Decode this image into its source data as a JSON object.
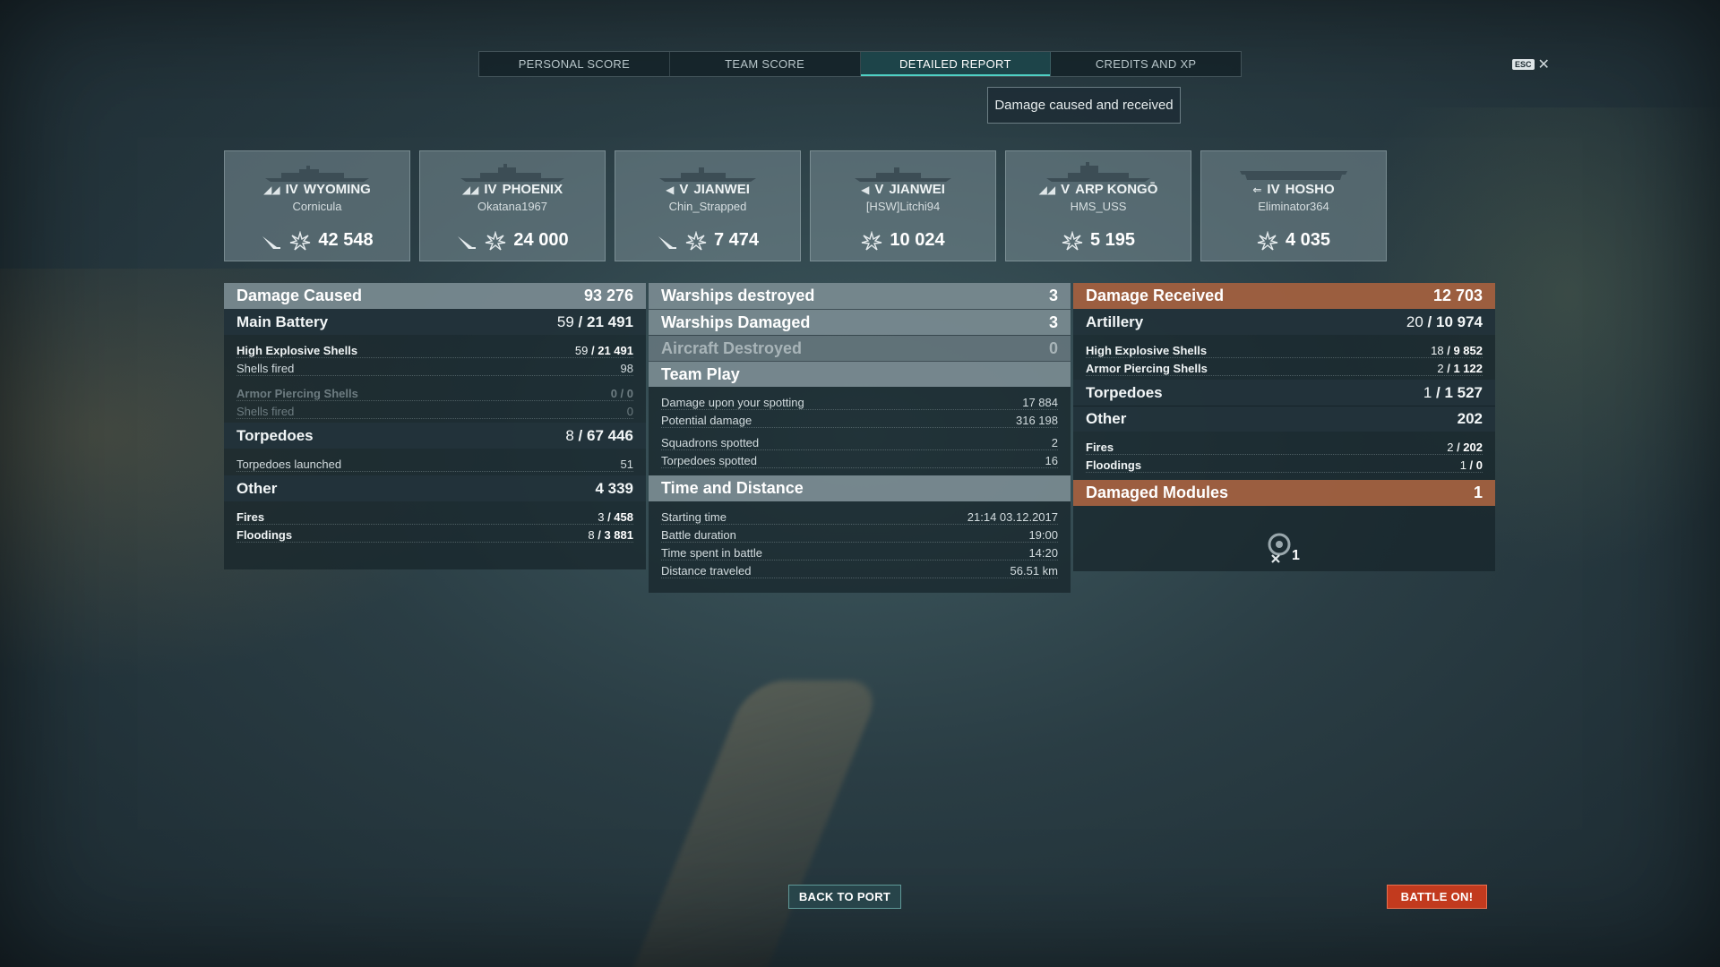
{
  "tabs": [
    {
      "label": "PERSONAL SCORE",
      "active": false
    },
    {
      "label": "TEAM SCORE",
      "active": false
    },
    {
      "label": "DETAILED REPORT",
      "active": true
    },
    {
      "label": "CREDITS AND XP",
      "active": false
    }
  ],
  "close": {
    "esc_label": "ESC",
    "x_label": "✕"
  },
  "subtab": {
    "label": "Damage caused and received"
  },
  "ships": [
    {
      "tier": "IV",
      "name": "WYOMING",
      "player": "Cornicula",
      "damage": "42 548",
      "class": "battleship",
      "plane_icon": true
    },
    {
      "tier": "IV",
      "name": "PHOENIX",
      "player": "Okatana1967",
      "damage": "24 000",
      "class": "battleship",
      "plane_icon": true
    },
    {
      "tier": "V",
      "name": "JIANWEI",
      "player": "Chin_Strapped",
      "damage": "7 474",
      "class": "cruiser",
      "plane_icon": true
    },
    {
      "tier": "V",
      "name": "JIANWEI",
      "player": "[HSW]Litchi94",
      "damage": "10 024",
      "class": "cruiser",
      "plane_icon": false
    },
    {
      "tier": "V",
      "name": "ARP KONGŌ",
      "player": "HMS_USS",
      "damage": "5 195",
      "class": "battleship",
      "plane_icon": false
    },
    {
      "tier": "IV",
      "name": "HOSHO",
      "player": "Eliminator364",
      "damage": "4 035",
      "class": "carrier",
      "plane_icon": false
    }
  ],
  "damage_caused": {
    "title": "Damage Caused",
    "total": "93 276",
    "main_battery": {
      "label": "Main Battery",
      "hits": "59",
      "damage": "21 491"
    },
    "he": {
      "label": "High Explosive Shells",
      "hits": "59",
      "damage": "21 491"
    },
    "he_fired": {
      "label": "Shells fired",
      "value": "98"
    },
    "ap": {
      "label": "Armor Piercing Shells",
      "value": "0 / 0"
    },
    "ap_fired": {
      "label": "Shells fired",
      "value": "0"
    },
    "torpedoes": {
      "label": "Torpedoes",
      "hits": "8",
      "damage": "67 446"
    },
    "torp_launched": {
      "label": "Torpedoes launched",
      "value": "51"
    },
    "other": {
      "label": "Other",
      "value": "4 339"
    },
    "fires": {
      "label": "Fires",
      "hits": "3",
      "damage": "458"
    },
    "floodings": {
      "label": "Floodings",
      "hits": "8",
      "damage": "3 881"
    }
  },
  "middle": {
    "warships_destroyed": {
      "label": "Warships destroyed",
      "value": "3"
    },
    "warships_damaged": {
      "label": "Warships Damaged",
      "value": "3"
    },
    "aircraft_destroyed": {
      "label": "Aircraft Destroyed",
      "value": "0"
    },
    "team_play": {
      "label": "Team Play"
    },
    "spotting_dmg": {
      "label": "Damage upon your spotting",
      "value": "17 884"
    },
    "potential": {
      "label": "Potential damage",
      "value": "316 198"
    },
    "squadrons": {
      "label": "Squadrons spotted",
      "value": "2"
    },
    "torp_spotted": {
      "label": "Torpedoes spotted",
      "value": "16"
    },
    "time_distance": {
      "label": "Time and Distance"
    },
    "start": {
      "label": "Starting time",
      "value": "21:14  03.12.2017"
    },
    "duration": {
      "label": "Battle duration",
      "value": "19:00"
    },
    "time_in_battle": {
      "label": "Time spent in battle",
      "value": "14:20"
    },
    "distance": {
      "label": "Distance traveled",
      "value": "56.51 km"
    }
  },
  "damage_received": {
    "title": "Damage Received",
    "total": "12 703",
    "artillery": {
      "label": "Artillery",
      "hits": "20",
      "damage": "10 974"
    },
    "he": {
      "label": "High Explosive Shells",
      "hits": "18",
      "damage": "9 852"
    },
    "ap": {
      "label": "Armor Piercing Shells",
      "hits": "2",
      "damage": "1 122"
    },
    "torpedoes": {
      "label": "Torpedoes",
      "hits": "1",
      "damage": "1 527"
    },
    "other": {
      "label": "Other",
      "value": "202"
    },
    "fires": {
      "label": "Fires",
      "hits": "2",
      "damage": "202"
    },
    "floodings": {
      "label": "Floodings",
      "hits": "1",
      "damage": "0"
    },
    "modules": {
      "label": "Damaged Modules",
      "value": "1",
      "count": "1"
    }
  },
  "buttons": {
    "back_to_port": "BACK TO PORT",
    "battle_on": "BATTLE ON!"
  },
  "colors": {
    "accent_teal": "#4fd0c4",
    "received_header": "#aa6441",
    "battle_button": "#c23a1e"
  }
}
